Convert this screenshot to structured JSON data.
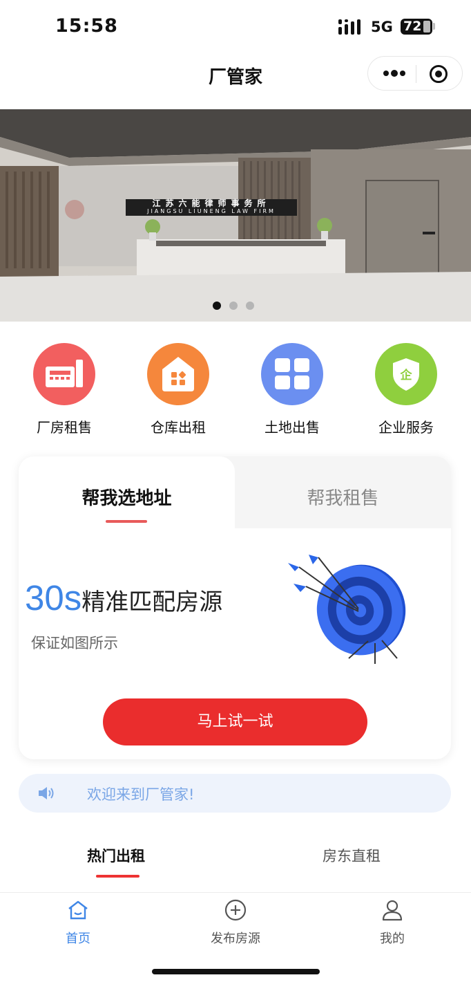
{
  "status_bar": {
    "time": "15:58",
    "network": "5G",
    "battery": "72"
  },
  "nav": {
    "title": "厂管家"
  },
  "banner": {
    "sign_cn": "江苏六能律师事务所",
    "sign_en": "JIANGSU LIUNENG LAW FIRM",
    "slide_count": 3,
    "active_slide": 1
  },
  "categories": [
    {
      "label": "厂房租售",
      "icon": "factory-icon",
      "color": "#f25f5f"
    },
    {
      "label": "仓库出租",
      "icon": "warehouse-icon",
      "color": "#f5873c"
    },
    {
      "label": "土地出售",
      "icon": "land-grid-icon",
      "color": "#6b8ff0"
    },
    {
      "label": "企业服务",
      "icon": "enterprise-shield-icon",
      "color": "#8fcf3e"
    }
  ],
  "card": {
    "tab_active": "帮我选地址",
    "tab_inactive": "帮我租售",
    "headline_num": "30s",
    "headline_text": "精准匹配房源",
    "subline": "保证如图所示",
    "cta": "马上试一试"
  },
  "notice": {
    "text": "欢迎来到厂管家!"
  },
  "list_tabs": {
    "active": "热门出租",
    "inactive": "房东直租"
  },
  "tabbar": {
    "items": [
      {
        "label": "首页",
        "icon": "home-icon",
        "active": true
      },
      {
        "label": "发布房源",
        "icon": "plus-circle-icon",
        "active": false
      },
      {
        "label": "我的",
        "icon": "user-icon",
        "active": false
      }
    ]
  },
  "colors": {
    "accent_blue": "#3f86e6",
    "cta_red": "#ea2d2d",
    "tab_indicator": "#e33333"
  }
}
